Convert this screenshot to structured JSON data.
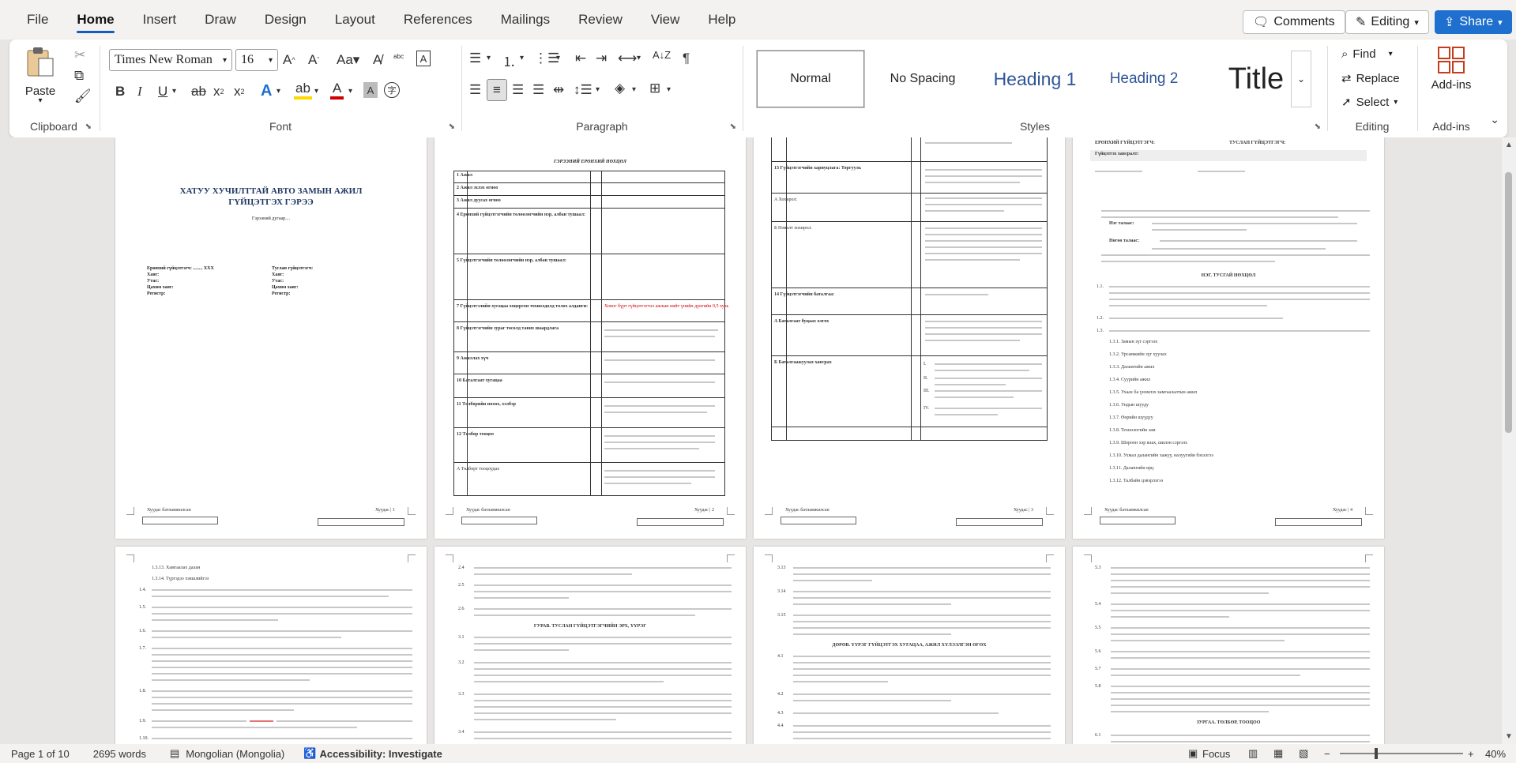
{
  "menu": {
    "tabs": [
      "File",
      "Home",
      "Insert",
      "Draw",
      "Design",
      "Layout",
      "References",
      "Mailings",
      "Review",
      "View",
      "Help"
    ],
    "active": "Home"
  },
  "top_right": {
    "comments": "Comments",
    "editing": "Editing",
    "share": "Share"
  },
  "ribbon": {
    "clipboard": {
      "paste": "Paste",
      "label": "Clipboard"
    },
    "font": {
      "name": "Times New Roman",
      "size": "16",
      "label": "Font"
    },
    "paragraph": {
      "label": "Paragraph"
    },
    "styles": {
      "items": [
        "Normal",
        "No Spacing",
        "Heading 1",
        "Heading 2",
        "Title"
      ],
      "label": "Styles"
    },
    "editing": {
      "find": "Find",
      "replace": "Replace",
      "select": "Select",
      "label": "Editing"
    },
    "addins": {
      "button": "Add-ins",
      "label": "Add-ins"
    }
  },
  "pages": {
    "p1": {
      "title_line1": "ХАТУУ ХУЧИЛТТАЙ АВТО ЗАМЫН АЖИЛ",
      "title_line2": "ГҮЙЦЭТГЭХ ГЭРЭЭ",
      "subtitle": "Гэрээний дугаар....",
      "left_block": [
        "Ерөнхий гүйцэтгэгч: ........ XXX",
        "Хаяг:",
        "Утас:",
        "Цахим хаяг:",
        "Регистр:"
      ],
      "right_block": [
        "Туслан гүйцэтгэгч:",
        "Хаяг:",
        "Утас:",
        "Цахим хаяг:",
        "Регистр:"
      ],
      "footer_left": "Хуудас батламжилсан",
      "footer_right": "Хуудас | 1"
    },
    "p2": {
      "heading": "ГЭРЭЭНИЙ ЕРӨНХИЙ НӨХЦӨЛ",
      "rows": [
        "1  Ажил",
        "2  Ажил эхлэх огноо",
        "3  Ажил дуусах огноо",
        "4  Ерөнхий гүйцэтгэгчийн төлөөлөгчийн нэр, албан тушаал:",
        "5  Гүйцэтгэгчийн төлөөлөгчийн нэр, албан тушаал:",
        "7  Гүйцэтгэлийн хугацаа хоцорсон тохиолдолд төлөх алданги:",
        "8  Гүйцэтгэгчийн зураг төсөлд тавих шаардлага",
        "9  Ажиллах хүч",
        "10  Баталгаат хугацаа",
        "11  Төлбөрийн нөхөх, хэлбэр",
        "12  Төлбөр тооцоо",
        "A  Төлбөрт тооцоудах"
      ],
      "red_note": "Хоног бүрт гүйцэтгэгчээ ажлын нийт үнийн дүнгийн 0,5 хувь",
      "footer_left": "Хуудас батламжилсан",
      "footer_right": "Хуудас | 2"
    },
    "p3": {
      "rows": [
        "13  Гүйцэтгэгчийн хариуцлага: Торгууль",
        "A  Хохирол:",
        "Б  Нэмэлт хохирол:",
        "14  Гүйцэтгэгчийн баталгаа:",
        "A  Баталгаат буцаах олгох",
        "Б  Баталгаажуулах хавсрах"
      ],
      "roman": [
        "I.",
        "II.",
        "III.",
        "IV."
      ],
      "footer_left": "Хуудас батламжилсан",
      "footer_right": "Хуудас | 3"
    },
    "p4": {
      "sign_left": "ЕРӨНХИЙ ГҮЙЦЭТГЭГЧ:",
      "sign_right": "ТУСЛАН ГҮЙЦЭТГЭГЧ:",
      "sign_note": "Гүйцэтгэх хавсралт:",
      "intro_parties": [
        "Нэг талаас:",
        "Нөгөө талаас:"
      ],
      "section": "НЭГ. ТУСГАЙ НӨХЦӨЛ",
      "items": [
        "1.1.",
        "1.2.",
        "1.3.",
        "1.3.1. Замын зүг сэргээх",
        "1.3.2. Урсамжийн зүг хуулах",
        "1.3.3. Далангийн ажил",
        "1.3.4. Суурийн ажил",
        "1.3.5. Ухаах ба үнэмлэх хамгаалалтын ажил",
        "1.3.6. Ундын шууду",
        "1.3.7. Өөрийн шуудуу",
        "1.3.8. Технологийн зам",
        "1.3.9. Шороон хэр ялах, шилэн сэргээх",
        "1.3.10. Ухмал далангийн хажуу, налуугийн бэхэлгээ",
        "1.3.11. Далангийн өрц",
        "1.3.12. Талбайн цэвэрлэгээ"
      ],
      "footer_left": "Хуудас батламжилсан",
      "footer_right": "Хуудас | 4"
    },
    "p5": {
      "items": [
        "1.3.13. Хамгаалах далан",
        "1.3.14. Түргэдээ хэвшлийгээ",
        "1.4.",
        "1.5.",
        "1.6.",
        "1.7.",
        "1.8.",
        "1.9.",
        "1.10."
      ]
    },
    "p6": {
      "heading": "ГУРАВ. ТУСЛАН ГҮЙЦЭТГЭГЧИЙН ЭРХ, ҮҮРЭГ",
      "items": [
        "2.4",
        "2.5",
        "2.6",
        "3.1",
        "3.2",
        "3.3",
        "3.4"
      ]
    },
    "p7": {
      "heading": "ДӨРӨВ. ҮҮРЭГ ГҮЙЦЭТГЭХ ХУГАЦАА, АЖИЛ ХҮЛЭЭЛГЭН ӨГӨХ",
      "items": [
        "3.13",
        "3.14",
        "3.15",
        "4.1",
        "4.2",
        "4.3",
        "4.4"
      ]
    },
    "p8": {
      "heading": "ЗУРГАА. ТӨЛБӨР, ТООЦОО",
      "items": [
        "5.3",
        "5.4",
        "5.5",
        "5.6",
        "5.7",
        "5.8",
        "6.1"
      ]
    }
  },
  "status": {
    "page": "Page 1 of 10",
    "words": "2695 words",
    "language": "Mongolian (Mongolia)",
    "accessibility": "Accessibility: Investigate",
    "focus": "Focus",
    "zoom": "40%"
  },
  "colors": {
    "accent": "#185abd",
    "share": "#1f6fce",
    "heading_blue": "#2e5597",
    "red": "#d00000"
  }
}
